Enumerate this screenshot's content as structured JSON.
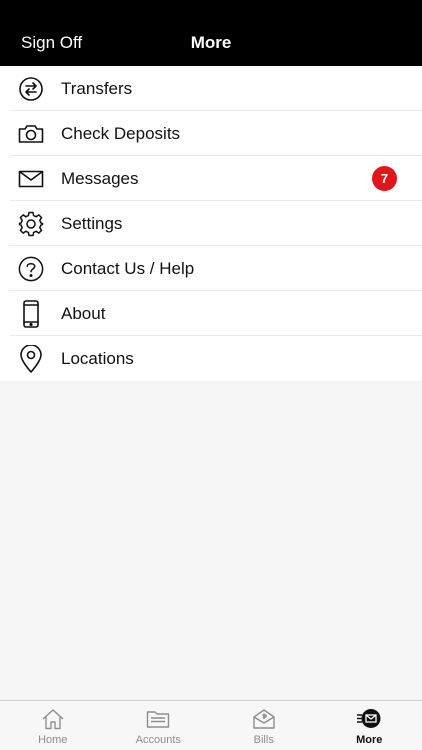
{
  "header": {
    "sign_off_label": "Sign Off",
    "title": "More"
  },
  "menu": {
    "items": [
      {
        "label": "Transfers",
        "icon": "transfer-arrows-icon"
      },
      {
        "label": "Check Deposits",
        "icon": "camera-icon"
      },
      {
        "label": "Messages",
        "icon": "envelope-icon",
        "badge": "7"
      },
      {
        "label": "Settings",
        "icon": "gear-icon"
      },
      {
        "label": "Contact Us / Help",
        "icon": "question-circle-icon"
      },
      {
        "label": "About",
        "icon": "phone-icon"
      },
      {
        "label": "Locations",
        "icon": "map-pin-icon"
      }
    ]
  },
  "tabbar": {
    "tabs": [
      {
        "label": "Home",
        "icon": "house-icon"
      },
      {
        "label": "Accounts",
        "icon": "folder-icon"
      },
      {
        "label": "Bills",
        "icon": "bill-envelope-icon"
      },
      {
        "label": "More",
        "icon": "more-envelope-icon",
        "active": true
      }
    ]
  },
  "colors": {
    "header_bg": "#000000",
    "badge": "#e0161b",
    "tab_inactive": "#8e8e8e"
  }
}
